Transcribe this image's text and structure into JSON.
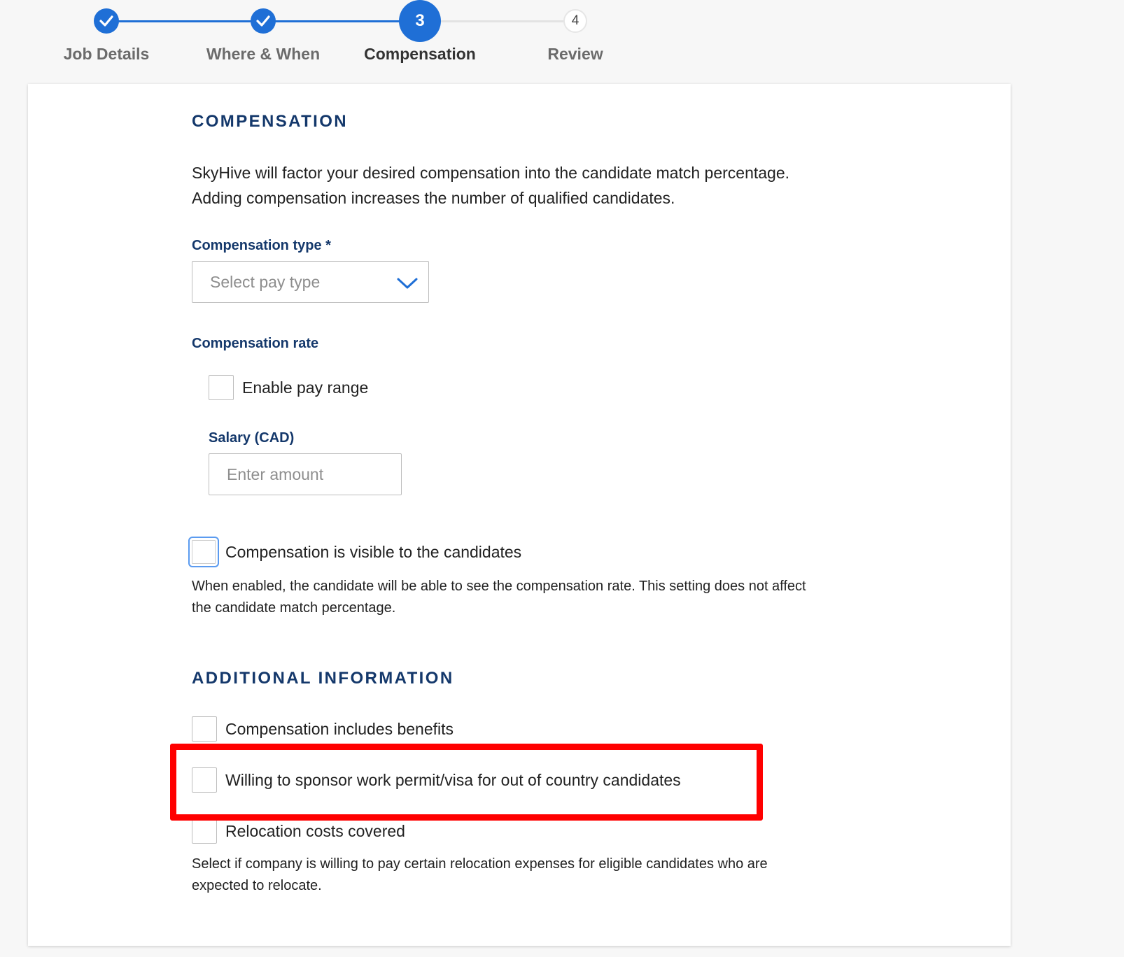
{
  "stepper": {
    "steps": [
      {
        "label": "Job Details",
        "status": "done",
        "number": ""
      },
      {
        "label": "Where & When",
        "status": "done",
        "number": ""
      },
      {
        "label": "Compensation",
        "status": "active",
        "number": "3"
      },
      {
        "label": "Review",
        "status": "todo",
        "number": "4"
      }
    ],
    "accent_color": "#1f6fd6"
  },
  "compensation": {
    "heading": "COMPENSATION",
    "intro_line1": "SkyHive will factor your desired compensation into the candidate match percentage.",
    "intro_line2": "Adding compensation increases the number of qualified candidates.",
    "type_label": "Compensation type *",
    "type_placeholder": "Select pay type",
    "rate_label": "Compensation rate",
    "enable_range_label": "Enable pay range",
    "salary_label": "Salary (CAD)",
    "salary_placeholder": "Enter amount",
    "visible_label": "Compensation is visible to the candidates",
    "visible_help_line1": "When enabled, the candidate will be able to see the compensation rate. This setting does not affect",
    "visible_help_line2": "the candidate match percentage."
  },
  "additional": {
    "heading": "ADDITIONAL INFORMATION",
    "benefits_label": "Compensation includes benefits",
    "sponsor_label": "Willing to sponsor work permit/visa for out of country candidates",
    "relocation_label": "Relocation costs covered",
    "relocation_help_line1": "Select if company is willing to pay certain relocation expenses for eligible candidates who are",
    "relocation_help_line2": "expected to relocate."
  },
  "annotation": {
    "highlight_color": "#ff0000"
  }
}
